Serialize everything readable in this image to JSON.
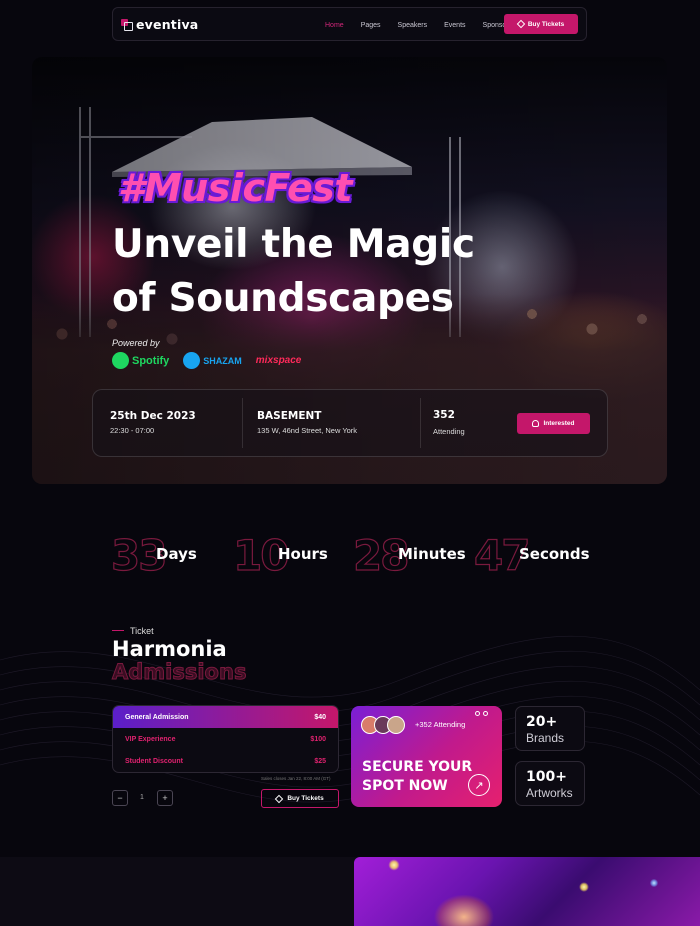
{
  "nav": {
    "logo": "eventiva",
    "links": [
      "Home",
      "Pages",
      "Speakers",
      "Events",
      "Sponsors"
    ],
    "active_link": "Home",
    "buy_label": "Buy Tickets"
  },
  "hero": {
    "hashtag": "#MusicFest",
    "headline_line1": "Unveil the Magic",
    "headline_line2": "of Soundscapes",
    "powered_by": "Powered by",
    "brands": [
      "Spotify",
      "SHAZAM",
      "mixspace"
    ]
  },
  "event": {
    "date": "25th Dec 2023",
    "time": "22:30 - 07:00",
    "venue": "BASEMENT",
    "address": "135 W, 46nd Street, New York",
    "attending_count": "352",
    "attending_label": "Attending",
    "interested_label": "Interested"
  },
  "countdown": [
    {
      "value": "33",
      "label": "Days"
    },
    {
      "value": "10",
      "label": "Hours"
    },
    {
      "value": "28",
      "label": "Minutes"
    },
    {
      "value": "47",
      "label": "Seconds"
    }
  ],
  "tickets": {
    "tag": "Ticket",
    "heading1": "Harmonia",
    "heading2": "Admissions",
    "rows": [
      {
        "name": "General Admission",
        "price": "$40"
      },
      {
        "name": "VIP Experience",
        "price": "$100"
      },
      {
        "name": "Student Discount",
        "price": "$25"
      }
    ],
    "sales_note": "Sales closes Jan 22, 8:00 AM (GT)",
    "quantity": "1",
    "minus": "−",
    "plus": "+",
    "buy_label": "Buy Tickets"
  },
  "secure": {
    "attending": "+352 Attending",
    "cta_line1": "SECURE YOUR",
    "cta_line2": "SPOT NOW",
    "arrow": "↗"
  },
  "stats": [
    {
      "num": "20+",
      "label": "Brands"
    },
    {
      "num": "100+",
      "label": "Artworks"
    }
  ],
  "colors": {
    "accent": "#c4176a",
    "background": "#07060d",
    "purple": "#7a1fd6"
  }
}
